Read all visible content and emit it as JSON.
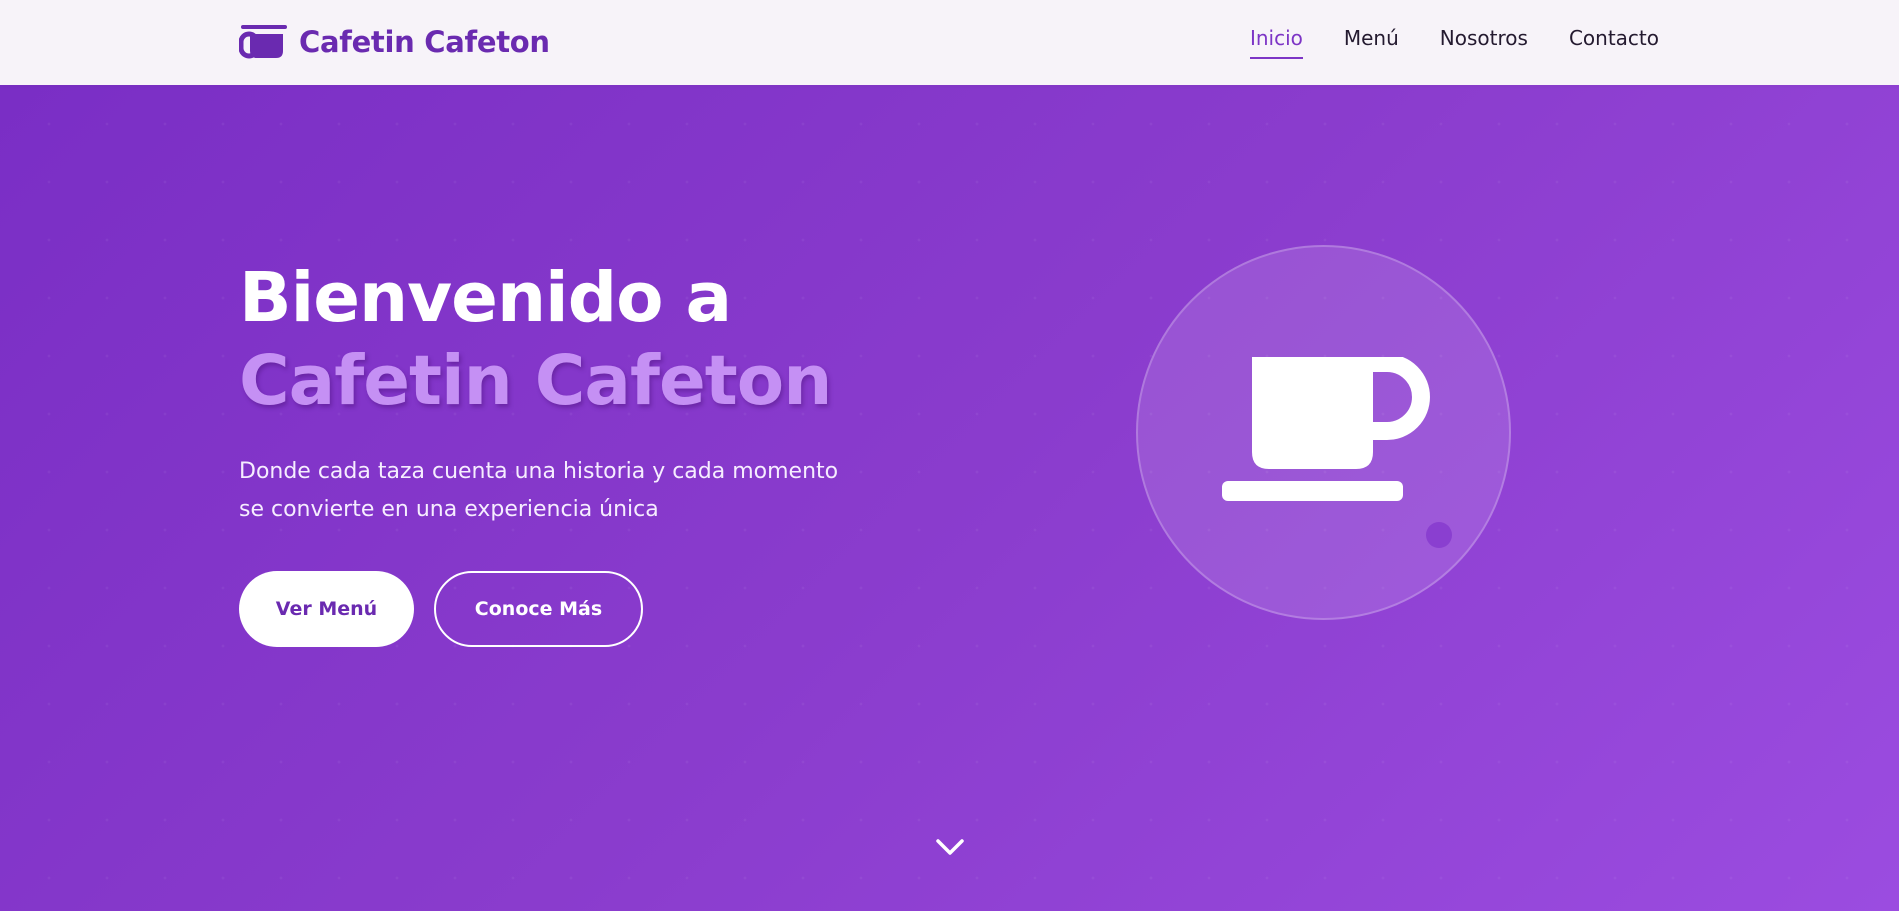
{
  "header": {
    "brand": "Cafetin Cafeton",
    "brand_icon": "coffee-cup-icon",
    "nav": [
      {
        "label": "Inicio",
        "active": true
      },
      {
        "label": "Menú",
        "active": false
      },
      {
        "label": "Nosotros",
        "active": false
      },
      {
        "label": "Contacto",
        "active": false
      }
    ]
  },
  "hero": {
    "title_line1": "Bienvenido a",
    "title_line2": "Cafetin Cafeton",
    "subtitle_line1": "Donde cada taza cuenta una historia y cada momento",
    "subtitle_line2": "se convierte en una experiencia única",
    "primary_button": "Ver Menú",
    "secondary_button": "Conoce Más",
    "illustration_icon": "coffee-cup-icon",
    "scroll_icon": "chevron-down-icon"
  },
  "colors": {
    "brand": "#6a2ab0",
    "accent": "#c590f4",
    "hero_gradient_start": "#7a2ec5",
    "hero_gradient_end": "#9b4ce0",
    "nav_background": "#f7f3f9"
  }
}
